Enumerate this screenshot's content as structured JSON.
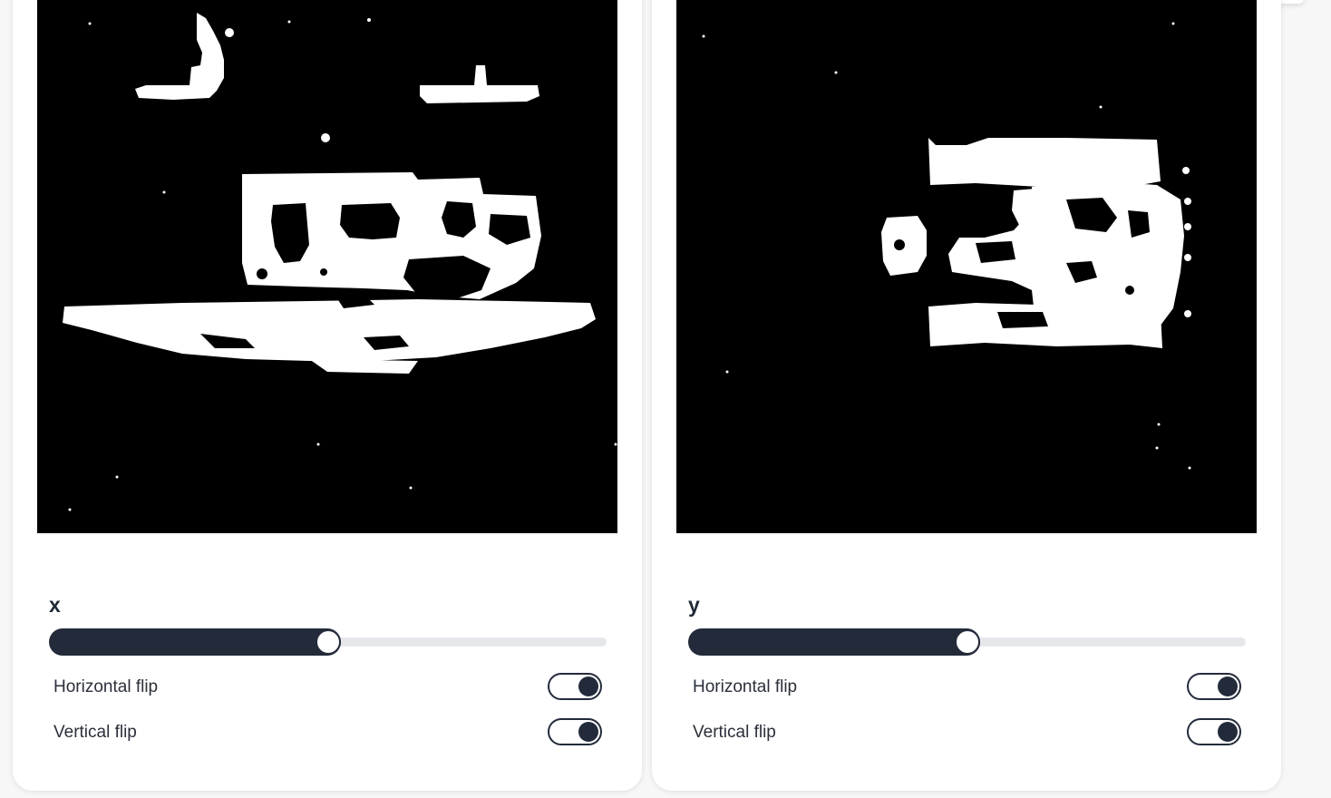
{
  "panels": [
    {
      "axis_label": "x",
      "slider_value_percent": 50,
      "toggles": [
        {
          "label": "Horizontal flip",
          "on": true
        },
        {
          "label": "Vertical flip",
          "on": true
        }
      ]
    },
    {
      "axis_label": "y",
      "slider_value_percent": 50,
      "toggles": [
        {
          "label": "Horizontal flip",
          "on": true
        },
        {
          "label": "Vertical flip",
          "on": true
        }
      ]
    }
  ],
  "colors": {
    "accent": "#232b3b",
    "track": "#e5e7eb",
    "image_background": "#000000",
    "image_foreground": "#ffffff"
  }
}
